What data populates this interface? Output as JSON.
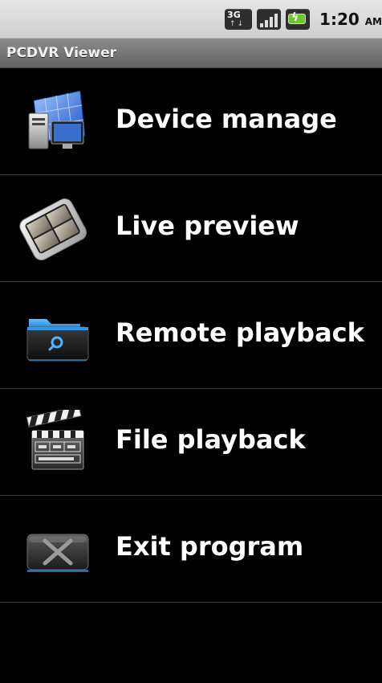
{
  "status_bar": {
    "network_label": "3G",
    "network_icon": "3g-data-icon",
    "signal_icon": "signal-strength-icon",
    "battery_icon": "battery-charging-icon",
    "time": "1:20",
    "ampm": "AM"
  },
  "app_bar": {
    "title": "PCDVR Viewer"
  },
  "menu": [
    {
      "label": "Device manage",
      "icon": "device-manage-icon"
    },
    {
      "label": "Live preview",
      "icon": "live-preview-phone-icon"
    },
    {
      "label": "Remote playback",
      "icon": "remote-playback-folder-icon"
    },
    {
      "label": "File playback",
      "icon": "file-playback-clapperboard-icon"
    },
    {
      "label": "Exit program",
      "icon": "exit-program-icon"
    }
  ],
  "colors": {
    "background": "#000000",
    "status_bar": "#dcdcdc",
    "title_bar": "#7a7a7a",
    "divider": "#3a3a3a",
    "text": "#ffffff"
  }
}
